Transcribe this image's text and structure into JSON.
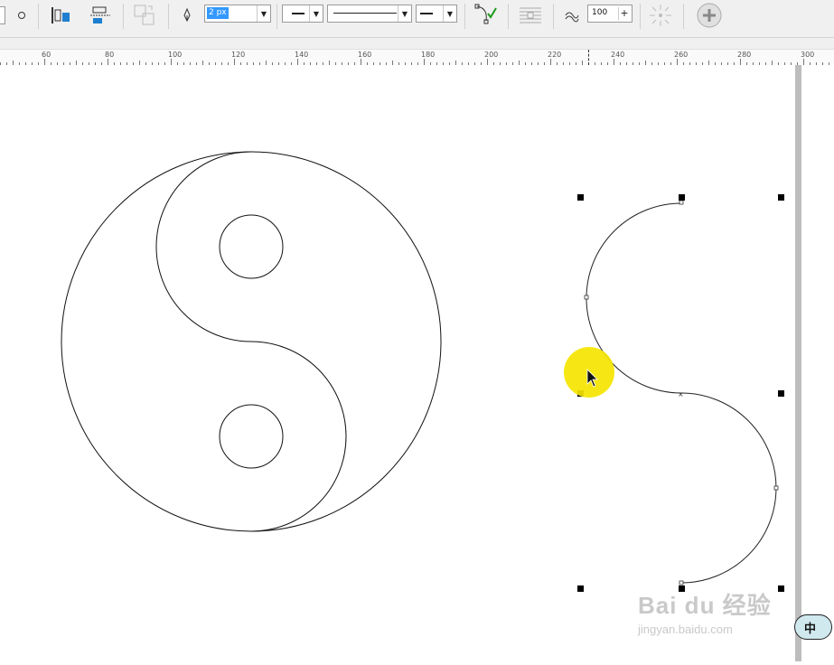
{
  "toolbar": {
    "outline_width_value": "2 px",
    "curve_smoothing_value": "100",
    "icons": {
      "circle": "circle-icon",
      "align_left": "align-objects-icon",
      "align_distribute": "distribute-objects-icon",
      "transform": "transform-icon",
      "pen": "outline-pen-icon",
      "line_start": "line-start-arrow-icon",
      "line_style": "line-style-icon",
      "line_end": "line-end-arrow-icon",
      "node_edit": "node-edit-icon",
      "text_wrap": "text-wrap-icon",
      "smoothing": "curve-smoothing-icon",
      "extract": "extract-icon",
      "add": "add-icon"
    }
  },
  "ruler": {
    "labels": [
      "60",
      "80",
      "100",
      "120",
      "140",
      "160",
      "180",
      "200",
      "220",
      "240",
      "260",
      "280",
      "300"
    ]
  },
  "canvas": {
    "drawings": [
      "yin-yang-outline",
      "s-curve-selected"
    ]
  },
  "watermark": {
    "brand": "Bai du 经验",
    "url": "jingyan.baidu.com"
  },
  "ime_indicator": {
    "label": "中"
  },
  "colors": {
    "toolbar_bg": "#f0f0f0",
    "highlight_cursor": "#f5e500",
    "selection_blue": "#3399ff"
  }
}
